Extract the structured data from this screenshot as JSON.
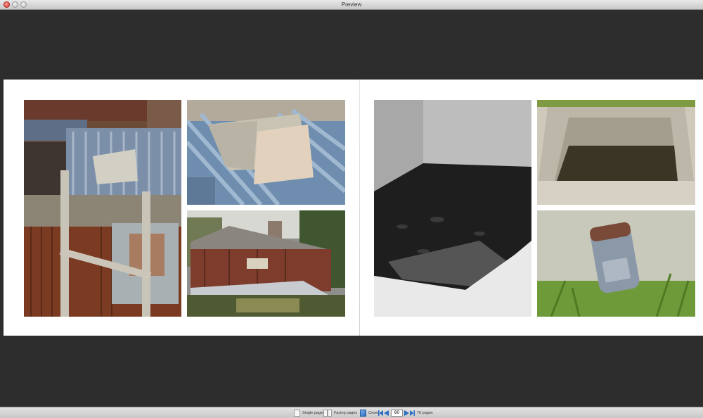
{
  "window": {
    "title": "Preview"
  },
  "toolbar": {
    "single_pages_label": "Single pages",
    "facing_pages_label": "Facing pages",
    "cover_label": "Cover",
    "current_page": "60",
    "total_pages_label": "76 pages"
  },
  "spread": {
    "left_page_photos": [
      "rusted-shed-ladder",
      "stone-on-corrugated-roof",
      "ruined-hut"
    ],
    "right_page_photos": [
      "concrete-water-trough-bw",
      "concrete-trough-green",
      "rusty-pipe-grass"
    ]
  },
  "colors": {
    "background": "#2d2d2d",
    "page": "#ffffff",
    "accent": "#2a6ec2"
  }
}
